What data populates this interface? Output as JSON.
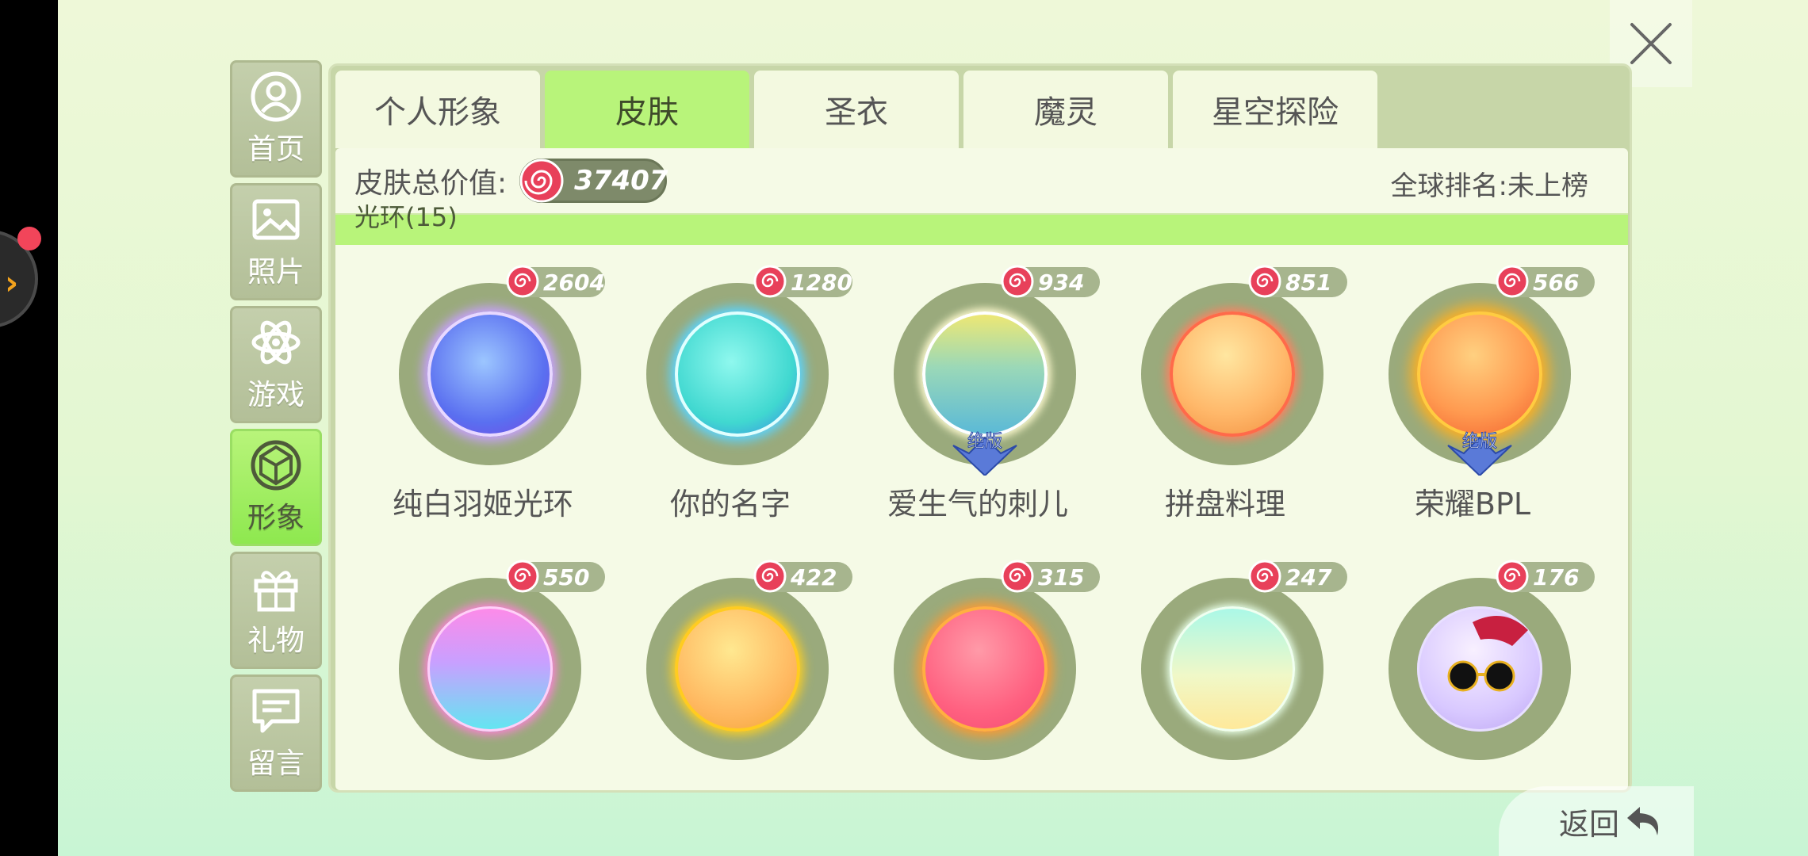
{
  "sidebar": {
    "items": [
      {
        "label": "首页",
        "icon": "person-icon"
      },
      {
        "label": "照片",
        "icon": "picture-icon"
      },
      {
        "label": "游戏",
        "icon": "atom-icon"
      },
      {
        "label": "形象",
        "icon": "gem-icon",
        "active": true
      },
      {
        "label": "礼物",
        "icon": "gift-icon"
      },
      {
        "label": "留言",
        "icon": "message-icon"
      }
    ]
  },
  "tabs": [
    {
      "label": "个人形象"
    },
    {
      "label": "皮肤",
      "active": true
    },
    {
      "label": "圣衣"
    },
    {
      "label": "魔灵"
    },
    {
      "label": "星空探险"
    }
  ],
  "summary": {
    "total_value_label": "皮肤总价值:",
    "total_value": "37407",
    "rank_text": "全球排名:未上榜"
  },
  "section": {
    "label": "光环(15)"
  },
  "skins": [
    {
      "name": "纯白羽姬光环",
      "price": "2604",
      "badge": ""
    },
    {
      "name": "你的名字",
      "price": "1280",
      "badge": ""
    },
    {
      "name": "爱生气的刺儿",
      "price": "934",
      "badge": "绝版"
    },
    {
      "name": "拼盘料理",
      "price": "851",
      "badge": ""
    },
    {
      "name": "荣耀BPL",
      "price": "566",
      "badge": "绝版"
    },
    {
      "name": "",
      "price": "550",
      "badge": ""
    },
    {
      "name": "",
      "price": "422",
      "badge": ""
    },
    {
      "name": "",
      "price": "315",
      "badge": ""
    },
    {
      "name": "",
      "price": "247",
      "badge": ""
    },
    {
      "name": "",
      "price": "176",
      "badge": ""
    }
  ],
  "back": {
    "label": "返回"
  },
  "colors": {
    "accent_green": "#b8f47a",
    "candy_red": "#e8405a"
  }
}
